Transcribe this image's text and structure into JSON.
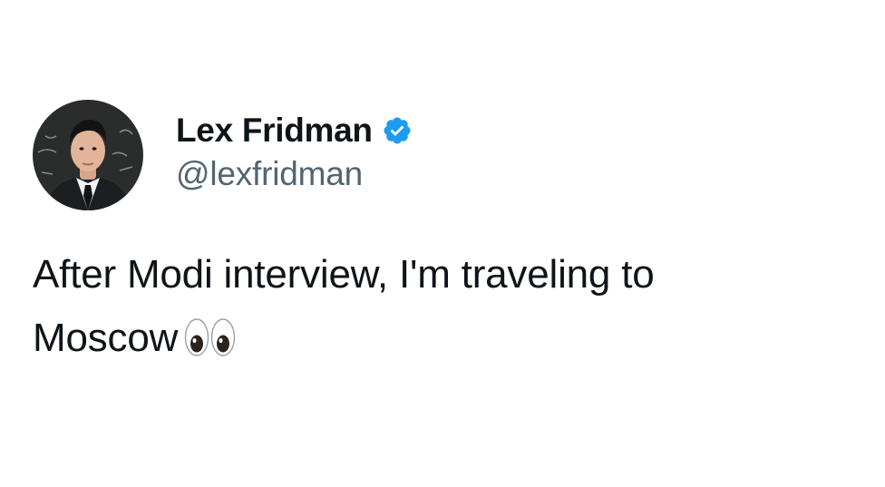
{
  "tweet": {
    "author": {
      "display_name": "Lex Fridman",
      "handle": "@lexfridman",
      "verified": true,
      "avatar_icon": "profile-photo",
      "verified_icon": "verified-badge-icon",
      "verified_color": "#1d9bf0"
    },
    "text_line_1": "After Modi interview, I'm traveling to",
    "text_line_2": "Moscow",
    "emoji_icon": "eyes-emoji-icon"
  },
  "colors": {
    "background": "#ffffff",
    "name": "#0f1419",
    "handle": "#536471",
    "body_text": "#0f1419"
  }
}
